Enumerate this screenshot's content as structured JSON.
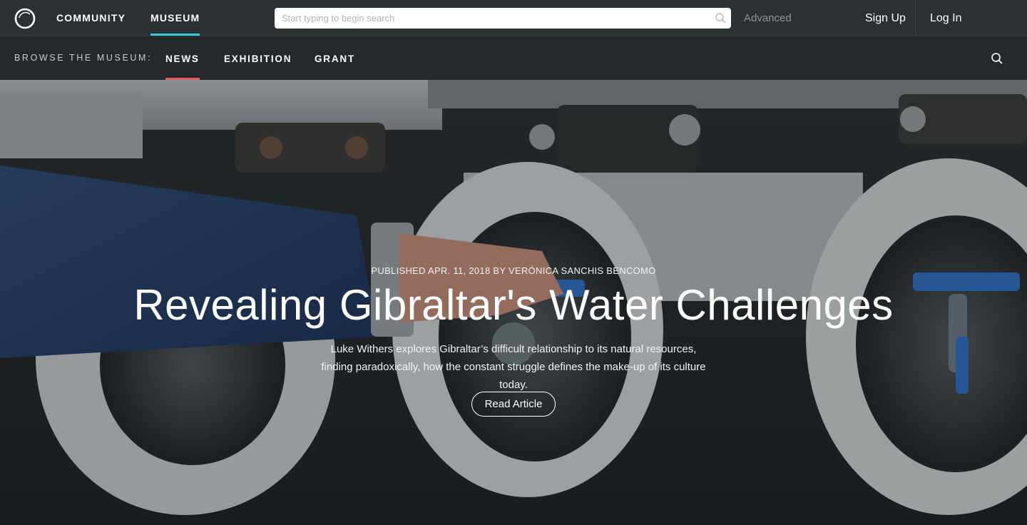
{
  "topbar": {
    "nav": [
      {
        "label": "COMMUNITY",
        "active": false
      },
      {
        "label": "MUSEUM",
        "active": true
      }
    ],
    "search": {
      "placeholder": "Start typing to begin search"
    },
    "advanced_label": "Advanced",
    "signup_label": "Sign Up",
    "login_label": "Log In"
  },
  "subbar": {
    "browse_label": "BROWSE THE MUSEUM:",
    "tabs": [
      {
        "label": "NEWS",
        "active": true
      },
      {
        "label": "EXHIBITION",
        "active": false
      },
      {
        "label": "GRANT",
        "active": false
      }
    ]
  },
  "hero": {
    "byline": "PUBLISHED APR. 11, 2018 BY VERÓNICA SANCHIS BENCOMO",
    "title": "Revealing Gibraltar's Water Challenges",
    "summary": "Luke Withers explores Gibraltar’s difficult relationship to its natural resources, finding paradoxically, how the constant struggle defines the make-up of its culture today.",
    "cta_label": "Read Article"
  },
  "colors": {
    "topbar_bg": "#2b3033",
    "subbar_bg": "#24292c",
    "museum_underline": "#3ec6d6",
    "news_underline": "#e35b62"
  },
  "icons": {
    "logo": "ring-logo-icon",
    "search": "search-icon"
  }
}
